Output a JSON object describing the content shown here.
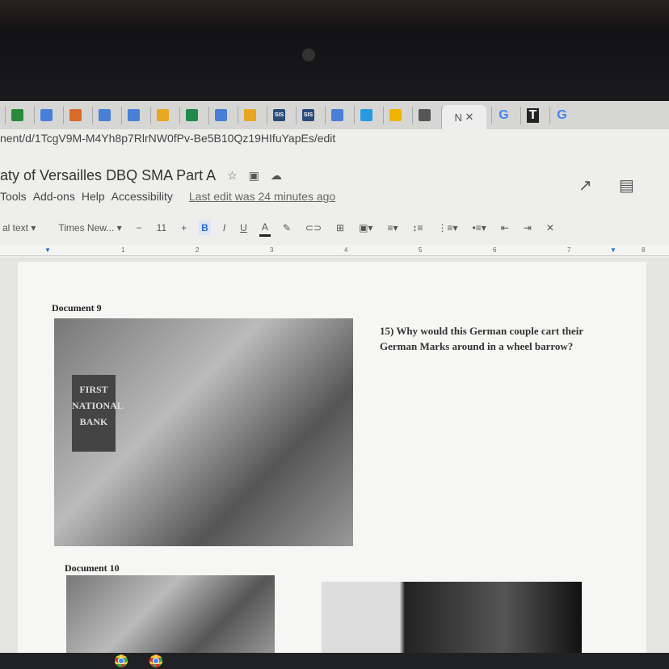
{
  "browser": {
    "tabs": [
      {
        "icon": "gmail",
        "color": "#2a8a3a"
      },
      {
        "icon": "docs",
        "color": "#4a7fd8"
      },
      {
        "icon": "person",
        "color": "#d86a2a"
      },
      {
        "icon": "docs",
        "color": "#4a7fd8"
      },
      {
        "icon": "docs",
        "color": "#4a7fd8"
      },
      {
        "icon": "slides",
        "color": "#e6a820"
      },
      {
        "icon": "sheets-plus",
        "color": "#1f8a4a"
      },
      {
        "icon": "docs",
        "color": "#4a7fd8"
      },
      {
        "icon": "slides",
        "color": "#e6a820"
      },
      {
        "icon": "sis",
        "color": "#2a4a7a",
        "label": "SIS"
      },
      {
        "icon": "sis",
        "color": "#2a4a7a",
        "label": "SIS"
      },
      {
        "icon": "docs",
        "color": "#4a7fd8"
      },
      {
        "icon": "compass",
        "color": "#2a9ae0"
      },
      {
        "icon": "drive",
        "color": "#f0b400"
      },
      {
        "icon": "classroom",
        "color": "#555"
      }
    ],
    "active_tab_label": "N",
    "extra_tabs": [
      "G",
      "T",
      "G"
    ],
    "url": "nent/d/1TcgV9M-M4Yh8p7RlrNW0fPv-Be5B10Qz19HIfuYapEs/edit"
  },
  "doc": {
    "title": "aty of Versailles DBQ SMA Part A",
    "menu": [
      "Tools",
      "Add-ons",
      "Help",
      "Accessibility"
    ],
    "last_edit": "Last edit was 24 minutes ago"
  },
  "toolbar": {
    "style": "al text",
    "font": "Times New...",
    "size": "11",
    "minus": "−",
    "plus": "+",
    "bold": "B",
    "italic": "I",
    "underline": "U",
    "color": "A"
  },
  "ruler": [
    "1",
    "2",
    "3",
    "4",
    "5",
    "6",
    "7",
    "8"
  ],
  "content": {
    "doc9_heading": "Document 9",
    "bank_sign": "FIRST NATIONAL BANK",
    "question": "15) Why would this German couple cart their German Marks around in a wheel barrow?",
    "doc10_heading": "Document 10"
  }
}
